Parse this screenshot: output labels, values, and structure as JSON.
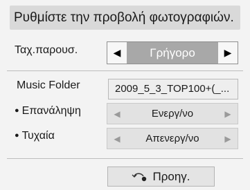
{
  "dialog": {
    "title": "Ρυθμίστε την προβολή φωτογραφιών."
  },
  "slide_speed": {
    "label": "Ταχ.παρουσ.",
    "value": "Γρήγορο",
    "left_arrow": "◀",
    "right_arrow": "▶"
  },
  "music_folder": {
    "label": "Music Folder",
    "value": "2009_5_3_TOP100+(_..."
  },
  "repeat": {
    "label": "Επανάληψη",
    "value": "Ενεργ/νο",
    "left_arrow": "◀",
    "right_arrow": "▶"
  },
  "shuffle": {
    "label": "Τυχαία",
    "value": "Απενεργ/νο",
    "left_arrow": "◀",
    "right_arrow": "▶"
  },
  "footer": {
    "back_label": "Προηγ.",
    "back_icon": "return-arrow-icon"
  }
}
